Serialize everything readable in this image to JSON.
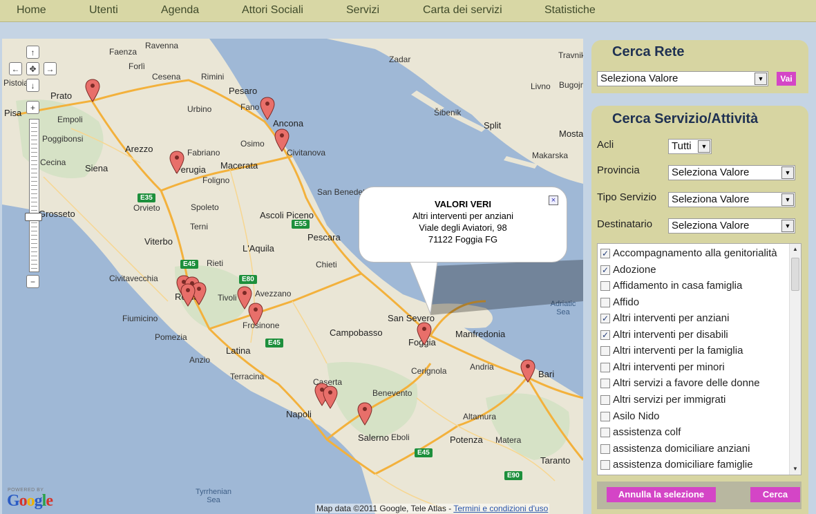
{
  "nav": {
    "items": [
      {
        "label": "Home"
      },
      {
        "label": "Utenti"
      },
      {
        "label": "Agenda"
      },
      {
        "label": "Attori Sociali"
      },
      {
        "label": "Servizi"
      },
      {
        "label": "Carta dei servizi"
      },
      {
        "label": "Statistiche"
      }
    ]
  },
  "map": {
    "cities": [
      {
        "name": "Ravenna"
      },
      {
        "name": "Faenza"
      },
      {
        "name": "Forlì"
      },
      {
        "name": "Cesena"
      },
      {
        "name": "Rimini"
      },
      {
        "name": "Prato"
      },
      {
        "name": "Pistoia"
      },
      {
        "name": "Empoli"
      },
      {
        "name": "Pisa"
      },
      {
        "name": "Poggibonsi"
      },
      {
        "name": "Pesaro"
      },
      {
        "name": "Urbino"
      },
      {
        "name": "Fano"
      },
      {
        "name": "Ancona"
      },
      {
        "name": "Osimo"
      },
      {
        "name": "Civitanova"
      },
      {
        "name": "Fabriano"
      },
      {
        "name": "Perugia"
      },
      {
        "name": "Macerata"
      },
      {
        "name": "Arezzo"
      },
      {
        "name": "Siena"
      },
      {
        "name": "Cecina"
      },
      {
        "name": "Grosseto"
      },
      {
        "name": "Foligno"
      },
      {
        "name": "Spoleto"
      },
      {
        "name": "Terni"
      },
      {
        "name": "Viterbo"
      },
      {
        "name": "Orvieto"
      },
      {
        "name": "Ascoli Piceno"
      },
      {
        "name": "San Benedetto del Tronto"
      },
      {
        "name": "L'Aquila"
      },
      {
        "name": "Pescara"
      },
      {
        "name": "Chieti"
      },
      {
        "name": "Rieti"
      },
      {
        "name": "Tivoli"
      },
      {
        "name": "Civitavecchia"
      },
      {
        "name": "Roma"
      },
      {
        "name": "Fiumicino"
      },
      {
        "name": "Pomezia"
      },
      {
        "name": "Latina"
      },
      {
        "name": "Anzio"
      },
      {
        "name": "Terracina"
      },
      {
        "name": "Frosinone"
      },
      {
        "name": "Avezzano"
      },
      {
        "name": "Campobasso"
      },
      {
        "name": "San Severo"
      },
      {
        "name": "Foggia"
      },
      {
        "name": "Manfredonia"
      },
      {
        "name": "Caserta"
      },
      {
        "name": "Benevento"
      },
      {
        "name": "Napoli"
      },
      {
        "name": "Salerno"
      },
      {
        "name": "Cerignola"
      },
      {
        "name": "Andria"
      },
      {
        "name": "Bari"
      },
      {
        "name": "Potenza"
      },
      {
        "name": "Altamura"
      },
      {
        "name": "Matera"
      },
      {
        "name": "Taranto"
      },
      {
        "name": "Eboli"
      },
      {
        "name": "Zadar"
      },
      {
        "name": "Šibenik"
      },
      {
        "name": "Split"
      },
      {
        "name": "Makarska"
      },
      {
        "name": "Travnik"
      },
      {
        "name": "Livno"
      },
      {
        "name": "Mostar"
      },
      {
        "name": "Bugojno"
      }
    ],
    "seas": [
      {
        "name": "Adriatic Sea"
      },
      {
        "name": "Tyrrhenian Sea"
      }
    ],
    "highways": [
      {
        "name": "E35"
      },
      {
        "name": "E45"
      },
      {
        "name": "E55"
      },
      {
        "name": "E80"
      },
      {
        "name": "E45"
      },
      {
        "name": "E45"
      },
      {
        "name": "E90"
      }
    ],
    "info_window": {
      "title": "VALORI VERI",
      "lines": [
        "Altri interventi per anziani",
        "Viale degli Aviatori, 98",
        "71122 Foggia FG"
      ]
    },
    "powered_by": "POWERED BY",
    "logo": "Google",
    "attribution": "Map data ©2011 Google, Tele Atlas -",
    "terms_link": "Termini e condizioni d'uso",
    "marker_color": "#e86f6a"
  },
  "cerca_rete": {
    "title": "Cerca Rete",
    "select_value": "Seleziona Valore",
    "go_label": "Vai"
  },
  "cerca_servizio": {
    "title": "Cerca Servizio/Attività",
    "fields": [
      {
        "label": "Acli",
        "value": "Tutti"
      },
      {
        "label": "Provincia",
        "value": "Seleziona Valore"
      },
      {
        "label": "Tipo Servizio",
        "value": "Seleziona Valore"
      },
      {
        "label": "Destinatario",
        "value": "Seleziona Valore"
      }
    ],
    "options": [
      {
        "label": "Accompagnamento alla genitorialità",
        "checked": true
      },
      {
        "label": "Adozione",
        "checked": true
      },
      {
        "label": "Affidamento in casa famiglia",
        "checked": false
      },
      {
        "label": "Affido",
        "checked": false
      },
      {
        "label": "Altri interventi per anziani",
        "checked": true
      },
      {
        "label": "Altri interventi per disabili",
        "checked": true
      },
      {
        "label": "Altri interventi per la famiglia",
        "checked": false
      },
      {
        "label": "Altri interventi per minori",
        "checked": false
      },
      {
        "label": "Altri servizi a favore delle donne",
        "checked": false
      },
      {
        "label": "Altri servizi per immigrati",
        "checked": false
      },
      {
        "label": "Asilo Nido",
        "checked": false
      },
      {
        "label": "assistenza colf",
        "checked": false
      },
      {
        "label": "assistenza domiciliare anziani",
        "checked": false
      },
      {
        "label": "assistenza domiciliare famiglie",
        "checked": false
      }
    ],
    "reset_label": "Annulla la selezione",
    "search_label": "Cerca"
  },
  "colors": {
    "panel": "#d7d5a2",
    "title": "#1f3152",
    "button": "#d445c6",
    "sea": "#9fb8d6",
    "land": "#eae6d6",
    "highway_shield": "#1d8f3c"
  }
}
